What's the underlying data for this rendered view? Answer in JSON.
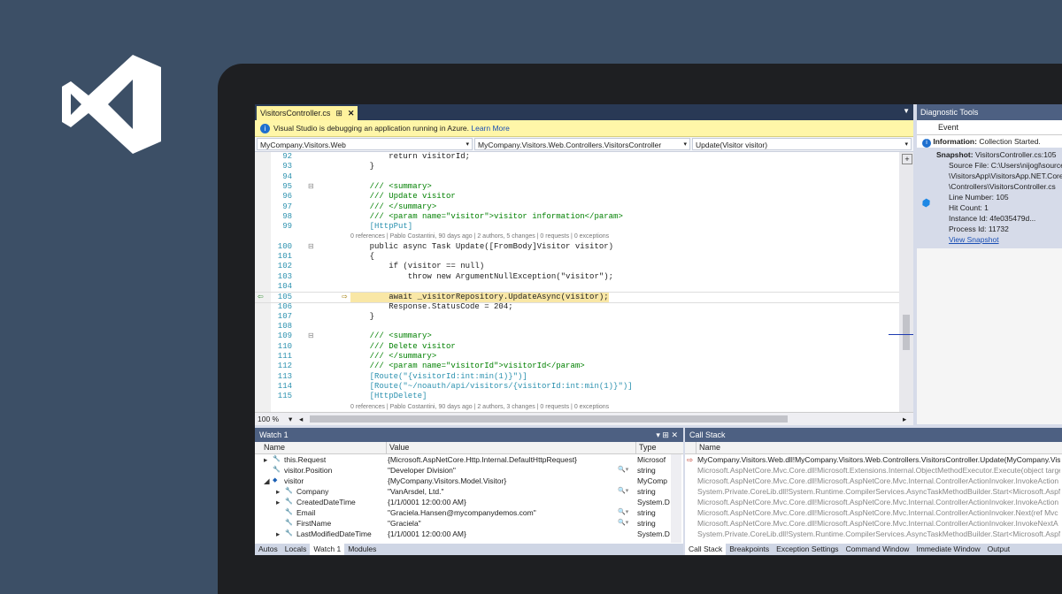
{
  "logo": {
    "name": "visual-studio-logo"
  },
  "editor": {
    "tab_label": "VisitorsController.cs",
    "tab_pin": "⊞",
    "tab_close": "✕",
    "info_text": "Visual Studio is debugging an application running in Azure.",
    "info_link": "Learn More",
    "nav_project": "MyCompany.Visitors.Web",
    "nav_class": "MyCompany.Visitors.Web.Controllers.VisitorsController",
    "nav_member": "Update(Visitor visitor)",
    "zoom": "100 %",
    "lines": [
      {
        "n": "92",
        "code": "        return visitorId;"
      },
      {
        "n": "93",
        "code": "    }"
      },
      {
        "n": "94",
        "code": ""
      },
      {
        "n": "95",
        "code": "    /// <summary>"
      },
      {
        "n": "96",
        "code": "    /// Update visitor"
      },
      {
        "n": "97",
        "code": "    /// </summary>"
      },
      {
        "n": "98",
        "code": "    /// <param name=\"visitor\">visitor information</param>"
      },
      {
        "n": "99",
        "code": "    [HttpPut]"
      },
      {
        "n": "",
        "code": "0 references | Pablo Costantini, 90 days ago | 2 authors, 5 changes | 0 requests | 0 exceptions"
      },
      {
        "n": "100",
        "code": "    public async Task Update([FromBody]Visitor visitor)"
      },
      {
        "n": "101",
        "code": "    {"
      },
      {
        "n": "102",
        "code": "        if (visitor == null)"
      },
      {
        "n": "103",
        "code": "            throw new ArgumentNullException(\"visitor\");"
      },
      {
        "n": "104",
        "code": ""
      },
      {
        "n": "105",
        "code": "        await _visitorRepository.UpdateAsync(visitor);"
      },
      {
        "n": "106",
        "code": "        Response.StatusCode = 204;"
      },
      {
        "n": "107",
        "code": "    }"
      },
      {
        "n": "108",
        "code": ""
      },
      {
        "n": "109",
        "code": "    /// <summary>"
      },
      {
        "n": "110",
        "code": "    /// Delete visitor"
      },
      {
        "n": "111",
        "code": "    /// </summary>"
      },
      {
        "n": "112",
        "code": "    /// <param name=\"visitorId\">visitorId</param>"
      },
      {
        "n": "113",
        "code": "    [Route(\"{visitorId:int:min(1)}\")]"
      },
      {
        "n": "114",
        "code": "    [Route(\"~/noauth/api/visitors/{visitorId:int:min(1)}\")]"
      },
      {
        "n": "115",
        "code": "    [HttpDelete]"
      },
      {
        "n": "",
        "code": "0 references | Pablo Costantini, 90 days ago | 2 authors, 3 changes | 0 requests | 0 exceptions"
      }
    ]
  },
  "diagnostic": {
    "title": "Diagnostic Tools",
    "col_event": "Event",
    "info_label": "Information:",
    "info_text": "Collection Started.",
    "snapshot_label": "Snapshot:",
    "snapshot_text": "VisitorsController.cs:105",
    "details": [
      "Source File: C:\\Users\\nijogl\\source",
      "\\VisitorsApp\\VisitorsApp.NET.Core",
      "\\Controllers\\VisitorsController.cs",
      "Line Number: 105",
      "Hit Count: 1",
      "Instance Id: 4fe035479d...",
      "Process Id: 11732"
    ],
    "view_link": "View Snapshot"
  },
  "watch": {
    "title": "Watch 1",
    "controls": "▾ ⊞ ✕",
    "cols": [
      "Name",
      "Value",
      "Type"
    ],
    "rows": [
      {
        "name": "this.Request",
        "value": "{Microsoft.AspNetCore.Http.Internal.DefaultHttpRequest}",
        "type": "Microsof"
      },
      {
        "name": "visitor.Position",
        "value": "\"Developer Division\"",
        "type": "string"
      },
      {
        "name": "visitor",
        "value": "{MyCompany.Visitors.Model.Visitor}",
        "type": "MyComp"
      },
      {
        "name": "Company",
        "value": "\"VanArsdel, Ltd.\"",
        "type": "string"
      },
      {
        "name": "CreatedDateTime",
        "value": "{1/1/0001 12:00:00 AM}",
        "type": "System.D"
      },
      {
        "name": "Email",
        "value": "\"Graciela.Hansen@mycompanydemos.com\"",
        "type": "string"
      },
      {
        "name": "FirstName",
        "value": "\"Graciela\"",
        "type": "string"
      },
      {
        "name": "LastModifiedDateTime",
        "value": "{1/1/0001 12:00:00 AM}",
        "type": "System.D"
      }
    ],
    "tabs": [
      "Autos",
      "Locals",
      "Watch 1",
      "Modules"
    ]
  },
  "callstack": {
    "title": "Call Stack",
    "col_name": "Name",
    "rows": [
      "MyCompany.Visitors.Web.dll!MyCompany.Visitors.Web.Controllers.VisitorsController.Update(MyCompany.Visitors",
      "Microsoft.AspNetCore.Mvc.Core.dll!Microsoft.Extensions.Internal.ObjectMethodExecutor.Execute(object target",
      "Microsoft.AspNetCore.Mvc.Core.dll!Microsoft.AspNetCore.Mvc.Internal.ControllerActionInvoker.InvokeAction",
      "System.Private.CoreLib.dll!System.Runtime.CompilerServices.AsyncTaskMethodBuilder.Start<Microsoft.AspNe",
      "Microsoft.AspNetCore.Mvc.Core.dll!Microsoft.AspNetCore.Mvc.Internal.ControllerActionInvoker.InvokeAction",
      "Microsoft.AspNetCore.Mvc.Core.dll!Microsoft.AspNetCore.Mvc.Internal.ControllerActionInvoker.Next(ref Mvc",
      "Microsoft.AspNetCore.Mvc.Core.dll!Microsoft.AspNetCore.Mvc.Internal.ControllerActionInvoker.InvokeNextA",
      "System.Private.CoreLib.dll!System.Runtime.CompilerServices.AsyncTaskMethodBuilder.Start<Microsoft.AspNe"
    ],
    "tabs": [
      "Call Stack",
      "Breakpoints",
      "Exception Settings",
      "Command Window",
      "Immediate Window",
      "Output"
    ]
  }
}
